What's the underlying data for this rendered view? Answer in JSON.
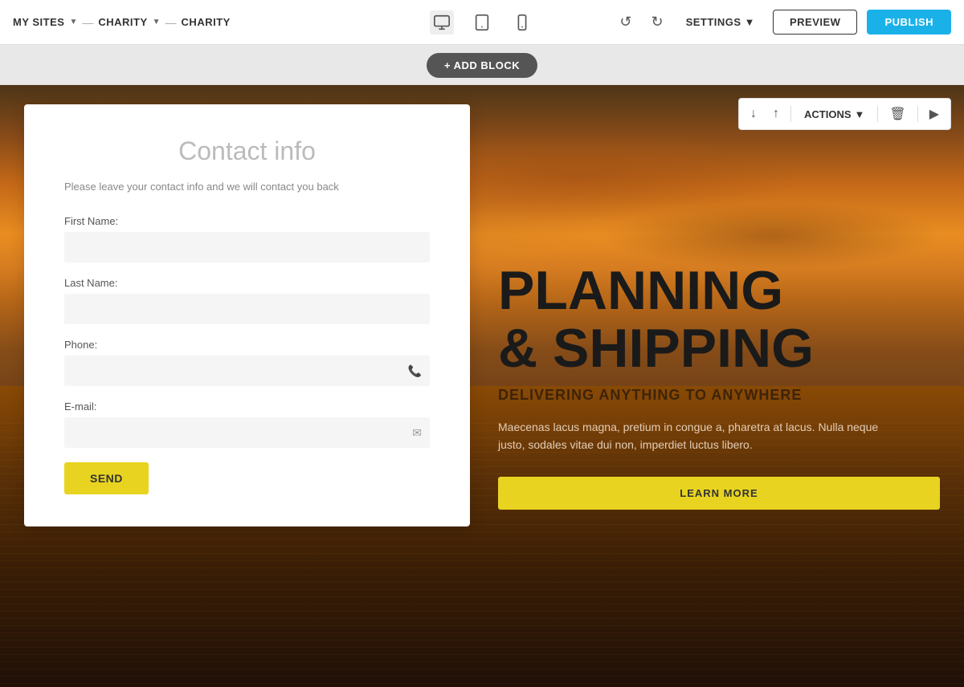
{
  "topbar": {
    "my_sites_label": "MY SITES",
    "breadcrumb_1": "CHARITY",
    "breadcrumb_2": "CHARITY",
    "settings_label": "SETTINGS",
    "preview_label": "PREVIEW",
    "publish_label": "PUBLISH"
  },
  "add_block": {
    "label": "+ ADD BLOCK"
  },
  "actions": {
    "label": "ACTIONS",
    "down_icon": "↓",
    "up_icon": "↑",
    "delete_icon": "🗑",
    "next_icon": "▶"
  },
  "contact_form": {
    "title": "Contact info",
    "subtitle": "Please leave your contact info and we will contact you back",
    "first_name_label": "First Name:",
    "last_name_label": "Last Name:",
    "phone_label": "Phone:",
    "email_label": "E-mail:",
    "send_label": "SEND"
  },
  "hero": {
    "title_line1": "PLANNING",
    "title_line2": "& SHIPPING",
    "subtitle": "DELIVERING ANYTHING TO ANYWHERE",
    "description": "Maecenas lacus magna, pretium in congue a, pharetra at lacus. Nulla neque justo, sodales vitae dui non, imperdiet luctus libero.",
    "cta_label": "LEARN MORE"
  }
}
